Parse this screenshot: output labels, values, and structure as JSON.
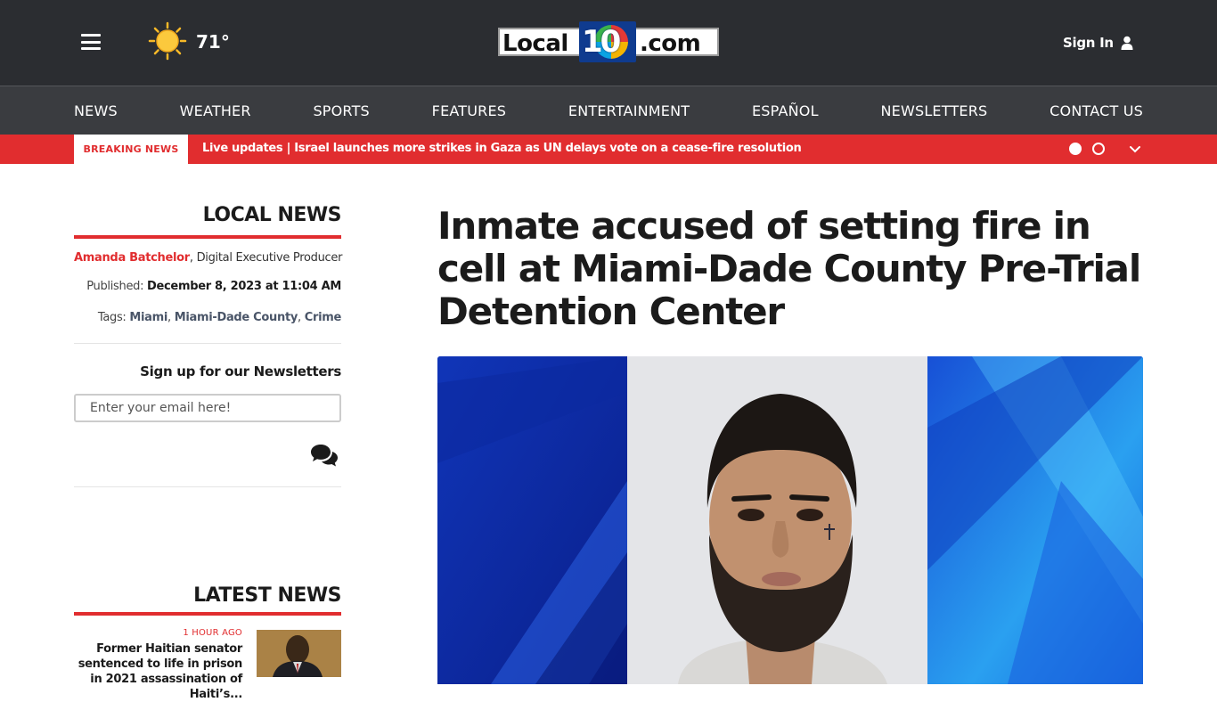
{
  "header": {
    "menu_icon": "hamburger-icon",
    "weather_icon": "sun-icon",
    "temperature": "71°",
    "logo": {
      "part1": "Local",
      "number": "10",
      "part2": ".com"
    },
    "sign_in": "Sign In",
    "user_icon": "user-icon"
  },
  "nav": {
    "items": [
      "NEWS",
      "WEATHER",
      "SPORTS",
      "FEATURES",
      "ENTERTAINMENT",
      "ESPAÑOL",
      "NEWSLETTERS",
      "CONTACT US"
    ]
  },
  "breaking": {
    "tag": "BREAKING NEWS",
    "headline": "Live updates | Israel launches more strikes in Gaza as UN delays vote on a cease-fire resolution"
  },
  "sidebar": {
    "section_title": "LOCAL NEWS",
    "author": "Amanda Batchelor",
    "author_role": ", Digital Executive Producer",
    "published_label": "Published: ",
    "published_date": "December 8, 2023 at 11:04 AM",
    "tags_label": "Tags: ",
    "tags": [
      "Miami",
      "Miami-Dade County",
      "Crime"
    ],
    "newsletter_title": "Sign up for our Newsletters",
    "email_placeholder": "Enter your email here!",
    "latest_title": "LATEST NEWS",
    "latest_item": {
      "time": "1 HOUR AGO",
      "title": "Former Haitian senator sentenced to life in prison in 2021 assassination of Haiti’s..."
    }
  },
  "article": {
    "headline": "Inmate accused of setting fire in cell at Miami-Dade County Pre-Trial Detention Center"
  },
  "colors": {
    "header_bg": "#2b2d31",
    "nav_bg": "#3a3c40",
    "accent_red": "#e12d2f",
    "tag_link": "#4a5568"
  }
}
